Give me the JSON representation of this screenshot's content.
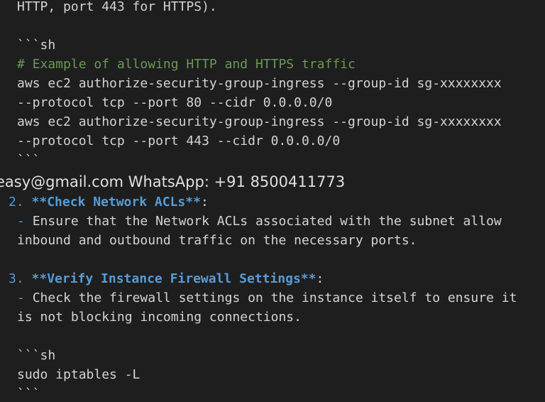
{
  "editor": {
    "lines": [
      {
        "segments": [
          {
            "t": "HTTP, port 443 for HTTPS).",
            "k": ""
          }
        ]
      },
      {
        "segments": [
          {
            "t": "```sh",
            "k": ""
          }
        ]
      },
      {
        "segments": [
          {
            "t": "# Example of allowing HTTP and HTTPS traffic",
            "k": "c"
          }
        ]
      },
      {
        "segments": [
          {
            "t": "aws ec2 authorize-security-group-ingress --group-id sg-xxxxxxxx",
            "k": ""
          }
        ]
      },
      {
        "segments": [
          {
            "t": "--protocol tcp --port 80 --cidr 0.0.0.0/0",
            "k": ""
          }
        ]
      },
      {
        "segments": [
          {
            "t": "aws ec2 authorize-security-group-ingress --group-id sg-xxxxxxxx",
            "k": ""
          }
        ]
      },
      {
        "segments": [
          {
            "t": "--protocol tcp --port 443 --cidr 0.0.0.0/0",
            "k": ""
          }
        ]
      },
      {
        "segments": [
          {
            "t": "```",
            "k": ""
          }
        ]
      },
      {
        "segments": [
          {
            "t": "2. ",
            "k": "h"
          },
          {
            "t": "**Check Network ACLs**",
            "k": "b"
          },
          {
            "t": ":",
            "k": ""
          }
        ]
      },
      {
        "segments": [
          {
            "t": "- ",
            "k": "h"
          },
          {
            "t": "Ensure that the Network ACLs associated with the subnet allow",
            "k": ""
          }
        ]
      },
      {
        "segments": [
          {
            "t": "inbound and outbound traffic on the necessary ports.",
            "k": ""
          }
        ]
      },
      {
        "segments": [
          {
            "t": "3. ",
            "k": "h"
          },
          {
            "t": "**Verify Instance Firewall Settings**",
            "k": "b"
          },
          {
            "t": ":",
            "k": ""
          }
        ]
      },
      {
        "segments": [
          {
            "t": "- ",
            "k": "h"
          },
          {
            "t": "Check the firewall settings on the instance itself to ensure it",
            "k": ""
          }
        ]
      },
      {
        "segments": [
          {
            "t": "is not blocking incoming connections.",
            "k": ""
          }
        ]
      },
      {
        "segments": [
          {
            "t": "```sh",
            "k": ""
          }
        ]
      },
      {
        "segments": [
          {
            "t": "sudo iptables -L",
            "k": ""
          }
        ]
      },
      {
        "segments": [
          {
            "t": "```",
            "k": ""
          }
        ]
      }
    ]
  },
  "watermark": {
    "text": "easy@gmail.com WhatsApp: +91 8500411773"
  }
}
